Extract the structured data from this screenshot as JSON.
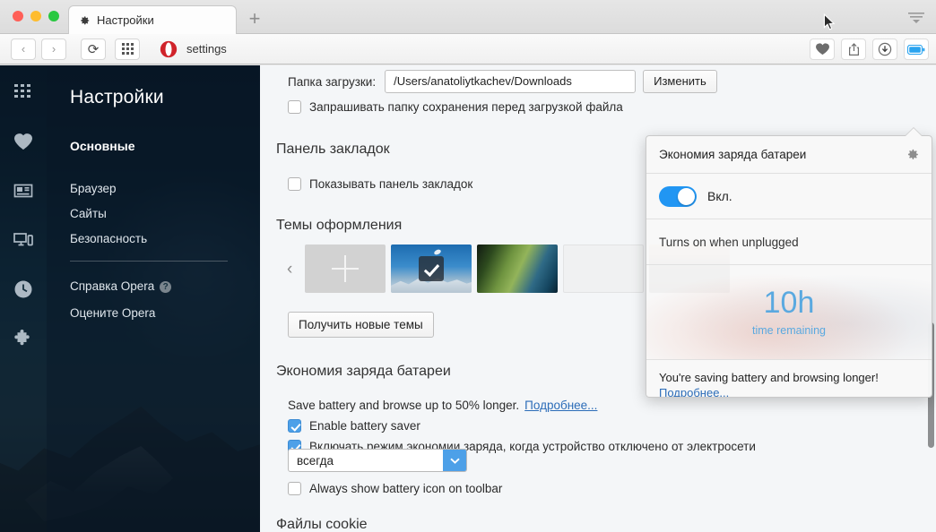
{
  "window": {
    "traffic_lights": [
      "close",
      "minimize",
      "maximize"
    ],
    "tab": {
      "title": "Настройки",
      "icon": "gear-icon"
    },
    "new_tab_label": "+",
    "menu_icon": "hamburger-menu-icon"
  },
  "addressbar": {
    "back_label": "‹",
    "forward_label": "›",
    "reload_label": "⟳",
    "speeddial_icon": "grid-icon",
    "opera_icon": "opera-logo-icon",
    "url": "settings",
    "right_icons": [
      {
        "name": "heart-icon",
        "label": "♥"
      },
      {
        "name": "share-icon",
        "label": "⇧"
      },
      {
        "name": "download-icon",
        "label": "↓"
      },
      {
        "name": "battery-icon",
        "label": "battery"
      }
    ]
  },
  "sidebar": {
    "rail_icons": [
      {
        "name": "speed-dial-icon"
      },
      {
        "name": "bookmarks-heart-icon"
      },
      {
        "name": "news-icon"
      },
      {
        "name": "my-flow-devices-icon"
      },
      {
        "name": "history-clock-icon"
      },
      {
        "name": "extensions-puzzle-icon"
      }
    ],
    "title": "Настройки",
    "items": [
      {
        "label": "Основные",
        "active": true
      },
      {
        "label": "Браузер",
        "active": false
      },
      {
        "label": "Сайты",
        "active": false
      },
      {
        "label": "Безопасность",
        "active": false
      }
    ],
    "footer_items": [
      {
        "label": "Справка Opera",
        "help_badge": "?"
      },
      {
        "label": "Оцените Opera",
        "help_badge": ""
      }
    ]
  },
  "content": {
    "download_folder": {
      "label": "Папка загрузки:",
      "value": "/Users/anatoliytkachev/Downloads",
      "change_button": "Изменить"
    },
    "ask_before_download": {
      "label": "Запрашивать папку сохранения перед загрузкой файла",
      "checked": false
    },
    "bookmarks_bar": {
      "heading": "Панель закладок",
      "show_label": "Показывать панель закладок",
      "checked": false
    },
    "themes": {
      "heading": "Темы оформления",
      "prev_arrow": "‹",
      "thumbnails": [
        {
          "name": "add-theme",
          "kind": "add",
          "selected": false
        },
        {
          "name": "mountain-theme",
          "kind": "mountain",
          "selected": true
        },
        {
          "name": "leaf-theme",
          "kind": "leaf",
          "selected": false
        },
        {
          "name": "blank-theme",
          "kind": "blank",
          "selected": false
        },
        {
          "name": "dark-theme",
          "kind": "dark",
          "selected": false
        }
      ],
      "get_more_button": "Получить новые темы"
    },
    "battery_saver": {
      "heading": "Экономия заряда батареи",
      "description": "Save battery and browse up to 50% longer.",
      "description_link": "Подробнее...",
      "enable_label": "Enable battery saver",
      "enable_checked": true,
      "unplugged_label": "Включать режим экономии заряда, когда устройство отключено от электросети",
      "unplugged_checked": true,
      "select_value": "всегда",
      "select_arrow": "⌄",
      "always_show_label": "Always show battery icon on toolbar",
      "always_show_checked": false
    },
    "cookies_heading": "Файлы cookie"
  },
  "popup": {
    "title": "Экономия заряда батареи",
    "gear_icon": "gear-icon",
    "toggle_on": true,
    "toggle_label": "Вкл.",
    "unplugged_text": "Turns on when unplugged",
    "time_value": "10h",
    "time_caption": "time remaining",
    "footer_text": "You're saving battery and browsing longer!",
    "footer_link": "Подробнее..."
  },
  "colors": {
    "accent_blue": "#4da0e8",
    "toggle_blue": "#2196f3",
    "link_blue": "#2b6cb8",
    "stat_blue": "#5aa9e0",
    "content_bg": "#f4f6f8"
  }
}
